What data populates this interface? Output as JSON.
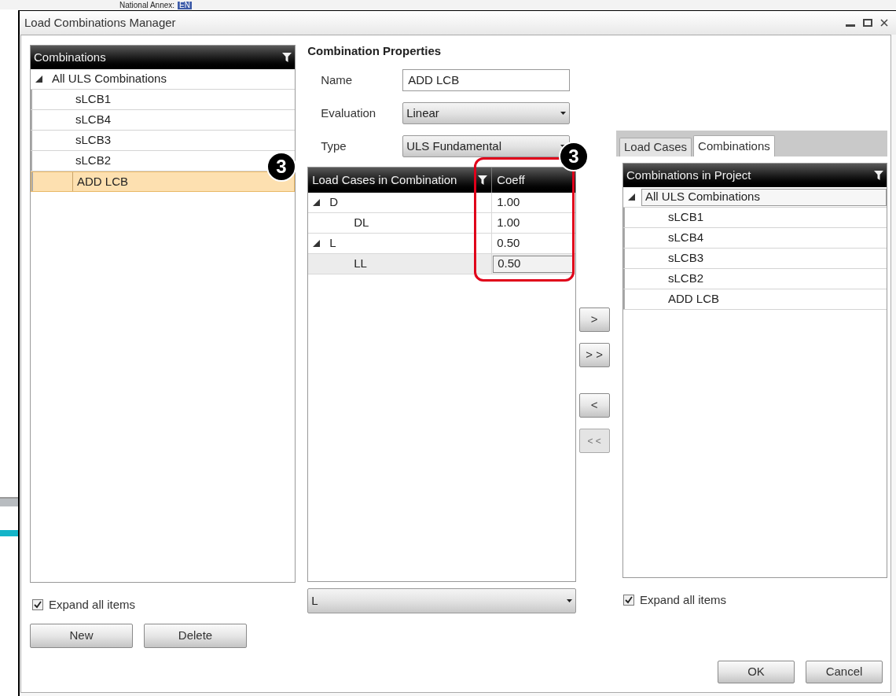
{
  "background_app": {
    "label": "National Annex:",
    "value": "EN"
  },
  "window": {
    "title": "Load Combinations Manager"
  },
  "combinations_panel": {
    "header": "Combinations",
    "tree": [
      {
        "label": "All ULS Combinations",
        "expanded": true,
        "selected": false,
        "children": [
          {
            "label": "sLCB1",
            "selected": false
          },
          {
            "label": "sLCB4",
            "selected": false
          },
          {
            "label": "sLCB3",
            "selected": false
          },
          {
            "label": "sLCB2",
            "selected": false
          },
          {
            "label": "ADD LCB",
            "selected": true
          }
        ]
      }
    ],
    "expand_all": {
      "label": "Expand all items",
      "checked": true
    },
    "buttons": [
      "New",
      "Delete"
    ]
  },
  "properties": {
    "title": "Combination Properties",
    "name": {
      "label": "Name",
      "value": "ADD LCB"
    },
    "evaluation": {
      "label": "Evaluation",
      "value": "Linear"
    },
    "type": {
      "label": "Type",
      "value": "ULS Fundamental"
    },
    "grid": {
      "columns": [
        "Load Cases in Combination",
        "Coeff"
      ],
      "rows": [
        {
          "name": "D",
          "coeff": "1.00",
          "expanded": true,
          "selected": false,
          "children": [
            {
              "name": "DL",
              "coeff": "1.00",
              "selected": false
            }
          ]
        },
        {
          "name": "L",
          "coeff": "0.50",
          "expanded": true,
          "selected": false,
          "children": [
            {
              "name": "LL",
              "coeff": "0.50",
              "selected": true
            }
          ]
        }
      ]
    },
    "case_select": {
      "value": "L"
    }
  },
  "transfer_buttons": [
    {
      "label": ">",
      "disabled": false
    },
    {
      "label": "> >",
      "disabled": false
    },
    {
      "label": "<",
      "disabled": false
    },
    {
      "label": "< <",
      "disabled": true
    }
  ],
  "project_panel": {
    "tabs": [
      {
        "label": "Load Cases",
        "selected": false
      },
      {
        "label": "Combinations",
        "selected": true
      }
    ],
    "header": "Combinations in Project",
    "tree": [
      {
        "label": "All ULS Combinations",
        "expanded": true,
        "selected": true,
        "children": [
          {
            "label": "sLCB1",
            "selected": false
          },
          {
            "label": "sLCB4",
            "selected": false
          },
          {
            "label": "sLCB3",
            "selected": false
          },
          {
            "label": "sLCB2",
            "selected": false
          },
          {
            "label": "ADD LCB",
            "selected": false
          }
        ]
      }
    ],
    "expand_all": {
      "label": "Expand all items",
      "checked": true
    }
  },
  "dialog_buttons": [
    "OK",
    "Cancel"
  ],
  "annotations": [
    {
      "label": "3"
    },
    {
      "label": "3"
    }
  ]
}
